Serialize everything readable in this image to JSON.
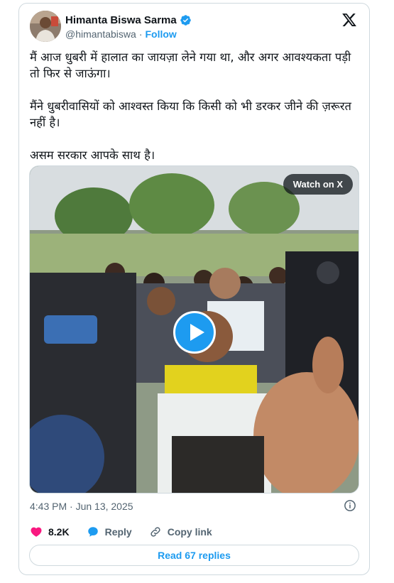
{
  "author": {
    "name": "Himanta Biswa Sarma",
    "handle": "@himantabiswa",
    "separator": "·",
    "follow_label": "Follow"
  },
  "tweet": {
    "paragraphs": [
      "मैं आज धुबरी में हालात का जायज़ा लेने गया था, और अगर आवश्यकता पड़ी तो फिर से जाऊंगा।",
      "मैंने धुबरीवासियों को आश्वस्त किया कि किसी को भी डरकर जीने की ज़रूरत नहीं है।",
      "असम सरकार आपके साथ है।"
    ]
  },
  "media": {
    "watch_label": "Watch on X"
  },
  "meta": {
    "timestamp": "4:43 PM · Jun 13, 2025"
  },
  "actions": {
    "like_count": "8.2K",
    "reply_label": "Reply",
    "copy_link_label": "Copy link"
  },
  "read_replies_label": "Read 67 replies",
  "icons": {
    "verified": "verified-badge-icon",
    "brand": "x-logo-icon",
    "info": "info-icon",
    "like": "heart-icon",
    "reply": "speech-bubble-icon",
    "copy": "link-icon"
  },
  "colors": {
    "accent": "#1d9bf0",
    "like": "#f91880",
    "text": "#0f1419",
    "muted": "#536471",
    "border": "#cfd9de"
  }
}
